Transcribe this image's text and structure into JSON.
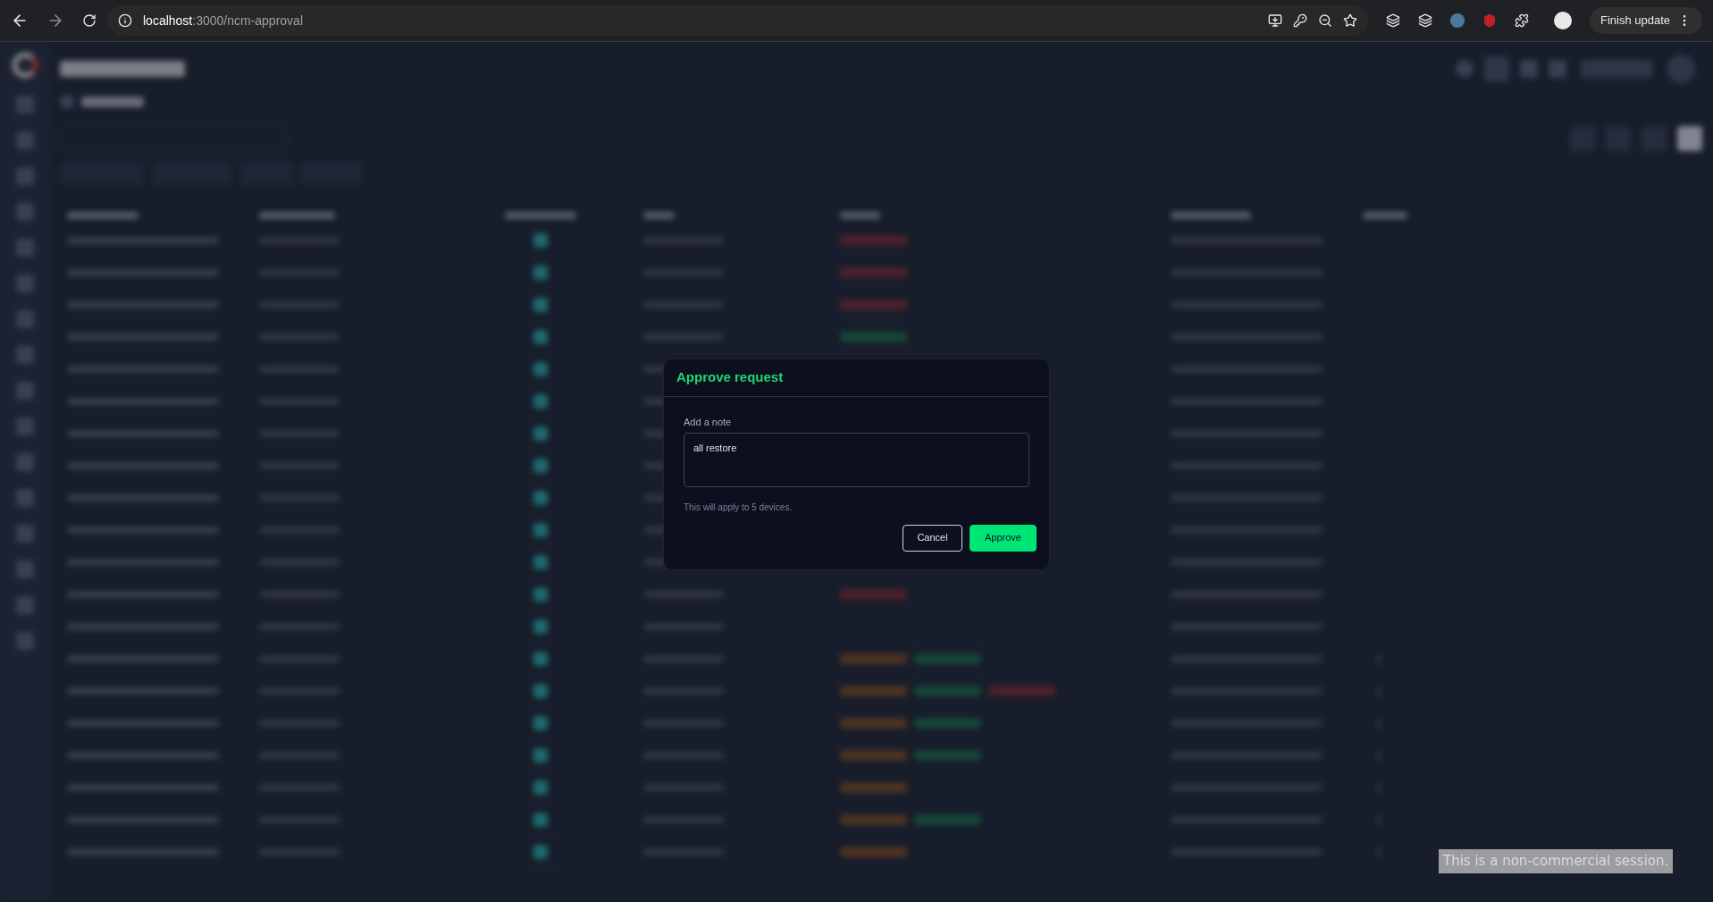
{
  "browser": {
    "url_host": "localhost",
    "url_path": ":3000/ncm-approval",
    "update_button": "Finish update"
  },
  "dialog": {
    "title": "Approve request",
    "note_label": "Add a note",
    "note_value": "all restore",
    "hint": "This will apply to 5 devices.",
    "buttons": [
      {
        "label": "Cancel",
        "kind": "secondary"
      },
      {
        "label": "Approve",
        "kind": "primary"
      }
    ]
  },
  "session_notice": "This is a non-commercial session."
}
